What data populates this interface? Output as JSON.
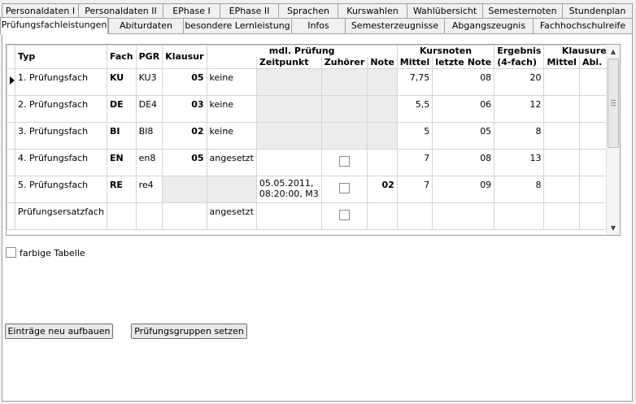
{
  "tabs_row1": [
    "Personaldaten I",
    "Personaldaten II",
    "EPhase I",
    "EPhase II",
    "Sprachen",
    "Kurswahlen",
    "Wahlübersicht",
    "Semesternoten",
    "Stundenplan"
  ],
  "tabs_row2": [
    "Prüfungsfachleistungen",
    "Abiturdaten",
    "besondere Lernleistung",
    "Infos",
    "Semesterzeugnisse",
    "Abgangszeugnis",
    "Fachhochschulreife"
  ],
  "active_tab": "Prüfungsfachleistungen",
  "grid": {
    "headers": {
      "typ": "Typ",
      "fach": "Fach",
      "pgr": "PGR",
      "klausur": "Klausur",
      "mdl_pruefung": "mdl. Prüfung",
      "zeitpunkt": "Zeitpunkt",
      "zuhoerer": "Zuhörer",
      "note": "Note",
      "kursnoten": "Kursnoten",
      "mittel": "Mittel",
      "letzte_note": "letzte Note",
      "ergebnis": "Ergebnis",
      "vierfach": "(4-fach)",
      "klausuren": "Klausuren",
      "k_mittel": "Mittel",
      "abi_bed": "Abi. Bed."
    },
    "rows": [
      {
        "typ": "1. Prüfungsfach",
        "fach": "KU",
        "pgr": "KU3",
        "klausur": "05",
        "status": "keine",
        "zeitpunkt": "",
        "zuhoerer": false,
        "note": "",
        "mittel": "7,75",
        "letzte": "08",
        "ergebnis": "20",
        "k_mittel": "",
        "abi": "",
        "current": true
      },
      {
        "typ": "2. Prüfungsfach",
        "fach": "DE",
        "pgr": "DE4",
        "klausur": "03",
        "status": "keine",
        "zeitpunkt": "",
        "zuhoerer": false,
        "note": "",
        "mittel": "5,5",
        "letzte": "06",
        "ergebnis": "12",
        "k_mittel": "",
        "abi": ""
      },
      {
        "typ": "3. Prüfungsfach",
        "fach": "BI",
        "pgr": "BI8",
        "klausur": "02",
        "status": "keine",
        "zeitpunkt": "",
        "zuhoerer": false,
        "note": "",
        "mittel": "5",
        "letzte": "05",
        "ergebnis": "8",
        "k_mittel": "",
        "abi": ""
      },
      {
        "typ": "4. Prüfungsfach",
        "fach": "EN",
        "pgr": "en8",
        "klausur": "05",
        "status": "angesetzt",
        "zeitpunkt": "",
        "zuhoerer": false,
        "note": "",
        "mittel": "7",
        "letzte": "08",
        "ergebnis": "13",
        "k_mittel": "",
        "abi": ""
      },
      {
        "typ": "5. Prüfungsfach",
        "fach": "RE",
        "pgr": "re4",
        "klausur": "",
        "status": "",
        "zeitpunkt_l1": "05.05.2011,",
        "zeitpunkt_l2": "08:20:00, M3",
        "zuhoerer": false,
        "note": "02",
        "mittel": "7",
        "letzte": "09",
        "ergebnis": "8",
        "k_mittel": "",
        "abi": ""
      },
      {
        "typ": "Prüfungsersatzfach",
        "fach": "",
        "pgr": "",
        "klausur": "",
        "status": "angesetzt",
        "zeitpunkt": "",
        "zuhoerer": false,
        "note": "",
        "mittel": "",
        "letzte": "",
        "ergebnis": "",
        "k_mittel": "",
        "abi": ""
      }
    ]
  },
  "farbige_tabelle": {
    "label": "farbige Tabelle",
    "checked": false
  },
  "buttons": {
    "rebuild": "Einträge neu aufbauen",
    "groups": "Prüfungsgruppen setzen"
  },
  "icons": {
    "scroll_up": "up-arrow-icon",
    "scroll_down": "down-arrow-icon",
    "row_pointer": "row-pointer-icon"
  }
}
